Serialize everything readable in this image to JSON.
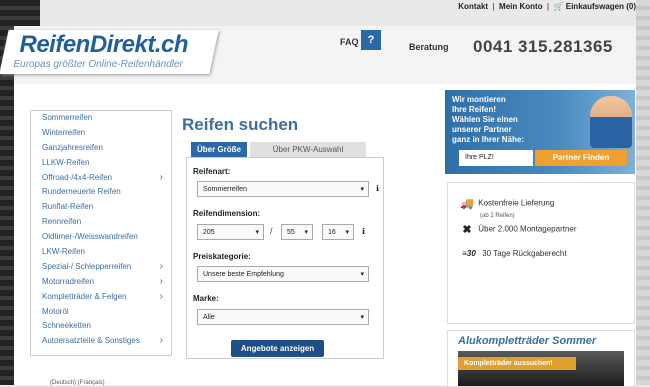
{
  "header": {
    "links": [
      "Kontakt",
      "Mein Konto"
    ],
    "cart": "Einkaufswagen (0)",
    "logo_text": "ReifenDirekt.ch",
    "logo_tagline": "Europas größter Online-Reifenhändler",
    "faq_label": "FAQ",
    "faq_icon": "?",
    "beratung_label": "Beratung",
    "phone": "0041 315.281365"
  },
  "sidebar": {
    "items": [
      {
        "label": "Sommerreifen",
        "arrow": false
      },
      {
        "label": "Winterreifen",
        "arrow": false
      },
      {
        "label": "Ganzjahresreifen",
        "arrow": false
      },
      {
        "label": "LLKW-Reifen",
        "arrow": false
      },
      {
        "label": "Offroad-/4x4-Reifen",
        "arrow": true
      },
      {
        "label": "Runderneuerte Reifen",
        "arrow": false
      },
      {
        "label": "Runflat-Reifen",
        "arrow": false
      },
      {
        "label": "Rennreifen",
        "arrow": false
      },
      {
        "label": "Oldtimer-/Weisswandreifen",
        "arrow": false
      },
      {
        "label": "LKW-Reifen",
        "arrow": false
      },
      {
        "label": "Spezial-/ Schlepperreifen",
        "arrow": true
      },
      {
        "label": "Motorradreifen",
        "arrow": true
      },
      {
        "label": "Kompletträder & Felgen",
        "arrow": true
      },
      {
        "label": "Motoröl",
        "arrow": false
      },
      {
        "label": "Schneeketten",
        "arrow": false
      },
      {
        "label": "Autoersatzteile & Sonstiges",
        "arrow": true
      }
    ]
  },
  "search": {
    "title": "Reifen suchen",
    "tab_active": "Über Größe",
    "tab_inactive": "Über PKW-Auswahl",
    "reifenart_label": "Reifenart:",
    "reifenart_value": "Sommerreifen",
    "dimension_label": "Reifendimension:",
    "width_value": "205",
    "ratio_value": "55",
    "rim_value": "16",
    "slash": "/",
    "preis_label": "Preiskategorie:",
    "preis_value": "Unsere beste Empfehlung",
    "marke_label": "Marke:",
    "marke_value": "Alle",
    "submit_label": "Angebote anzeigen"
  },
  "promo": {
    "line1": "Wir montieren",
    "line2": "Ihre Reifen!",
    "line3": "Wählen Sie einen",
    "line4": "unserer Partner",
    "line5": "ganz in Ihrer Nähe:",
    "plz_placeholder": "Ihre PLZ!",
    "finden_label": "Partner Finden"
  },
  "features": {
    "delivery": "Kostenfreie Lieferung",
    "delivery_sub": "(ab 2 Reifen)",
    "partners": "Über 2.000 Montagepartner",
    "return": "30 Tage Rückgaberecht",
    "return_icon_text": "≡30"
  },
  "alu": {
    "heading": "Alukompletträder Sommer",
    "button": "Kompletträder aussuchen!"
  },
  "footer": {
    "lang": "(Deutsch) (Français)"
  },
  "colors": {
    "brand_blue": "#2a69a5",
    "link_blue": "#3b6fa0",
    "accent_orange": "#f0a030"
  }
}
